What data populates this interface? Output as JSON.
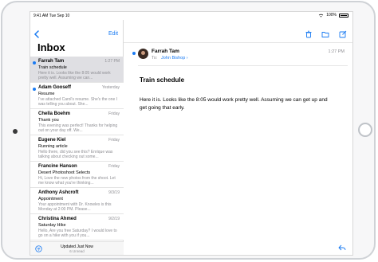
{
  "status": {
    "time": "9:41 AM",
    "date": "Tue Sep 10",
    "battery": "100%"
  },
  "sidebar": {
    "edit_label": "Edit",
    "title": "Inbox",
    "footer": {
      "updated": "Updated Just Now",
      "unread": "6 Unread"
    },
    "messages": [
      {
        "sender": "Farrah Tam",
        "time": "1:27 PM",
        "subject": "Train schedule",
        "preview": "Here it is. Looks like the 8:05 would work pretty well. Assuming we can...",
        "unread": true,
        "selected": true
      },
      {
        "sender": "Adam Gooseff",
        "time": "Yesterday",
        "subject": "Resume",
        "preview": "I've attached Carol's resume. She's the one I was telling you about. She...",
        "unread": true,
        "selected": false
      },
      {
        "sender": "Chella Boehm",
        "time": "Friday",
        "subject": "Thank you",
        "preview": "This evening was perfect! Thanks for helping out on your day off. We...",
        "unread": false,
        "selected": false
      },
      {
        "sender": "Eugene Kiel",
        "time": "Friday",
        "subject": "Running article",
        "preview": "Hello there, did you see this? Enrique was talking about checking out some...",
        "unread": false,
        "selected": false
      },
      {
        "sender": "Francine Hanson",
        "time": "Friday",
        "subject": "Desert Photoshoot Selects",
        "preview": "Hi, Love the new photos from the shoot. Let me know what you're thinking...",
        "unread": false,
        "selected": false
      },
      {
        "sender": "Anthony Ashcroft",
        "time": "9/3/19",
        "subject": "Appointment",
        "preview": "Your appointment with Dr. Knowles is this Monday at 2:00 PM. Please...",
        "unread": false,
        "selected": false
      },
      {
        "sender": "Christina Ahmed",
        "time": "9/2/19",
        "subject": "Saturday Hike",
        "preview": "Hello, Are you free Saturday? I would love to go on a hike with you if you...",
        "unread": false,
        "selected": false
      }
    ]
  },
  "detail": {
    "sender": "Farrah Tam",
    "time": "1:27 PM",
    "to_label": "To:",
    "to": "John Bishop ›",
    "subject": "Train schedule",
    "body": "Here it is. Looks like the 8:05 would work pretty well. Assuming we can get up and get going that early."
  },
  "colors": {
    "accent": "#1a7bf2",
    "selected_row": "#dfdfe3",
    "secondary_text": "#8e8e93"
  }
}
